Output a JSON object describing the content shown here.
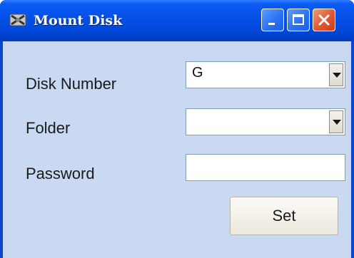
{
  "window": {
    "title": "Mount Disk",
    "title_icon": "mount-disk-app-icon",
    "controls": [
      "minimize",
      "maximize",
      "close"
    ]
  },
  "form": {
    "disk_number_label": "Disk Number",
    "disk_number_value": "G",
    "folder_label": "Folder",
    "folder_value": "",
    "password_label": "Password",
    "password_value": "",
    "set_button_label": "Set"
  },
  "colors": {
    "titlebar": "#0651e8",
    "client_background": "#c9d9f2",
    "close_button": "#e0562f"
  }
}
